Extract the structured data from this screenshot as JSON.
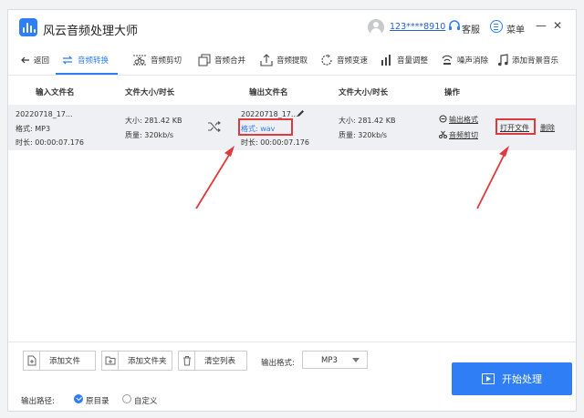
{
  "titlebar": {
    "app_title": "风云音频处理大师",
    "user_name": "123****8910",
    "kefu_label": "客服",
    "menu_label": "菜单",
    "minimize": "—",
    "close": "✕"
  },
  "toolbar": {
    "back": "返回",
    "items": [
      "音频转换",
      "音频剪切",
      "音频合并",
      "音频提取",
      "音频变速",
      "音量调整",
      "噪声消除",
      "添加背景音乐"
    ]
  },
  "table": {
    "headers": {
      "input_name": "输入文件名",
      "input_size": "文件大小/时长",
      "output_name": "输出文件名",
      "output_size": "文件大小/时长",
      "action": "操作"
    },
    "row": {
      "input_name": "20220718_17...",
      "input_format": "格式:   MP3",
      "input_duration": "时长:   00:00:07.176",
      "input_size": "大小:   281.42 KB",
      "input_quality": "质量:   320kb/s",
      "output_name": "20220718_17...",
      "output_format": "格式:   wav",
      "output_duration": "时长:   00:00:07.176",
      "output_size": "大小:   281.42 KB",
      "output_quality": "质量:   320kb/s",
      "output_format_btn": "输出格式",
      "clip_btn": "音频剪切",
      "open_file_btn": "打开文件",
      "delete_btn": "删除"
    }
  },
  "bottom": {
    "add_file": "添加文件",
    "add_folder": "添加文件夹",
    "clear_list": "清空列表",
    "format_label": "输出格式:",
    "format_value": "MP3",
    "start": "开始处理",
    "path_label": "输出路径:",
    "path_original": "原目录",
    "path_custom": "自定义"
  },
  "colors": {
    "accent": "#2f7ef5",
    "highlight_red": "#e0393e"
  }
}
